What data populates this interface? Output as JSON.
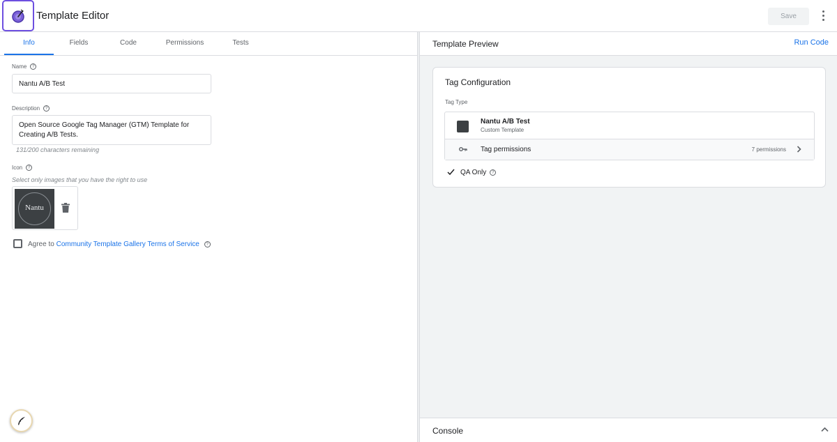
{
  "header": {
    "title": "Template Editor",
    "logo_icon": "gtm-template-logo-icon",
    "save_label": "Save",
    "more_icon": "kebab-menu-icon",
    "accent_color": "#6d4fe0"
  },
  "tabs": [
    {
      "label": "Info",
      "active": true
    },
    {
      "label": "Fields",
      "active": false
    },
    {
      "label": "Code",
      "active": false
    },
    {
      "label": "Permissions",
      "active": false
    },
    {
      "label": "Tests",
      "active": false
    }
  ],
  "info": {
    "name_label": "Name",
    "name_value": "Nantu A/B Test",
    "description_label": "Description",
    "description_value": "Open Source Google Tag Manager (GTM) Template for Creating A/B Tests.",
    "chars_remaining": "131/200 characters remaining",
    "icon_label": "Icon",
    "icon_hint": "Select only images that you have the right to use",
    "icon_text": "Nantu",
    "agree_prefix": "Agree to",
    "agree_link": "Community Template Gallery Terms of Service"
  },
  "preview": {
    "title": "Template Preview",
    "run_code": "Run Code",
    "card_title": "Tag Configuration",
    "tag_type_label": "Tag Type",
    "tag_name": "Nantu A/B Test",
    "tag_type": "Custom Template",
    "permissions_label": "Tag permissions",
    "permissions_count": "7 permissions",
    "qa_label": "QA Only"
  },
  "console": {
    "label": "Console"
  },
  "colors": {
    "link": "#1a73e8",
    "border": "#dadce0",
    "panel_bg": "#f1f3f4"
  }
}
